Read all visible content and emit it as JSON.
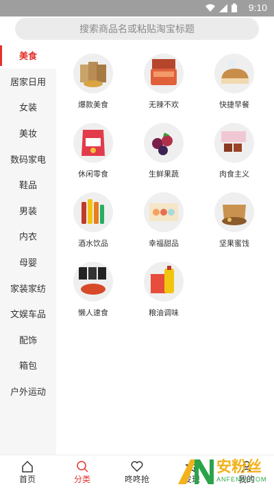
{
  "status": {
    "time": "9:10"
  },
  "search": {
    "placeholder": "搜索商品名或粘贴淘宝标题"
  },
  "sidebar": {
    "active_index": 0,
    "items": [
      {
        "label": "美食"
      },
      {
        "label": "居家日用"
      },
      {
        "label": "女装"
      },
      {
        "label": "美妆"
      },
      {
        "label": "数码家电"
      },
      {
        "label": "鞋品"
      },
      {
        "label": "男装"
      },
      {
        "label": "内衣"
      },
      {
        "label": "母婴"
      },
      {
        "label": "家装家纺"
      },
      {
        "label": "文娱车品"
      },
      {
        "label": "配饰"
      },
      {
        "label": "箱包"
      },
      {
        "label": "户外运动"
      }
    ]
  },
  "categories": [
    {
      "label": "爆款美食",
      "icon": "food-pack-image"
    },
    {
      "label": "无辣不欢",
      "icon": "spicy-jerky-image"
    },
    {
      "label": "快捷早餐",
      "icon": "bread-image"
    },
    {
      "label": "休闲零食",
      "icon": "snack-bag-image"
    },
    {
      "label": "生鲜果蔬",
      "icon": "berries-image"
    },
    {
      "label": "肉食主义",
      "icon": "meat-image"
    },
    {
      "label": "酒水饮品",
      "icon": "drink-bottles-image"
    },
    {
      "label": "幸福甜品",
      "icon": "macaron-box-image"
    },
    {
      "label": "坚果蜜饯",
      "icon": "nuts-box-image"
    },
    {
      "label": "懒人速食",
      "icon": "instant-noodles-image"
    },
    {
      "label": "粮油调味",
      "icon": "oil-rice-image"
    }
  ],
  "tabbar": {
    "active_index": 1,
    "items": [
      {
        "label": "首页",
        "icon": "home-icon"
      },
      {
        "label": "分类",
        "icon": "search-icon"
      },
      {
        "label": "咚咚抢",
        "icon": "heart-icon"
      },
      {
        "label": "发现",
        "icon": "star-icon"
      },
      {
        "label": "我的",
        "icon": "user-icon"
      }
    ]
  },
  "watermark": {
    "text": "安粉丝",
    "subtext": "ANFENSI.COM"
  },
  "colors": {
    "accent": "#e3312d",
    "status_bar": "#9e9e9e",
    "sidebar_bg": "#f6f6f6"
  }
}
